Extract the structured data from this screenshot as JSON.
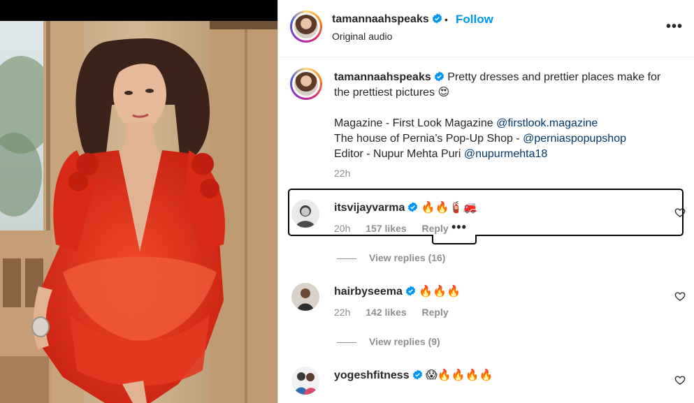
{
  "post": {
    "author": "tamannaahspeaks",
    "follow_label": "Follow",
    "separator": "•",
    "audio": "Original audio",
    "more_label": "•••"
  },
  "caption": {
    "author": "tamannaahspeaks",
    "text": "Pretty dresses and prettier places make for",
    "text2": "the prettiest pictures 😍",
    "credits": [
      {
        "label": "Magazine - First Look Magazine ",
        "mention": "@firstlook.magazine"
      },
      {
        "label": "The house of Pernia’s Pop-Up Shop - ",
        "mention": "@perniaspopupshop"
      },
      {
        "label": "Editor - Nupur Mehta Puri ",
        "mention": "@nupurmehta18"
      }
    ],
    "time": "22h"
  },
  "comments": [
    {
      "user": "itsvijayvarma",
      "text": "🔥🔥🧯🚒",
      "time": "20h",
      "likes": "157 likes",
      "reply": "Reply",
      "options": "•••",
      "view_replies": "View replies (16)"
    },
    {
      "user": "hairbyseema",
      "text": "🔥🔥🔥",
      "time": "22h",
      "likes": "142 likes",
      "reply": "Reply",
      "view_replies": "View replies (9)"
    },
    {
      "user": "yogeshfitness",
      "text": "😱🔥🔥🔥🔥"
    }
  ],
  "colors": {
    "accent": "#0095f6",
    "mention": "#00376b",
    "muted": "#8e8e8e",
    "dress": "#e8341c"
  },
  "icons": [
    "verified-badge-icon",
    "heart-icon",
    "more-options-icon"
  ]
}
